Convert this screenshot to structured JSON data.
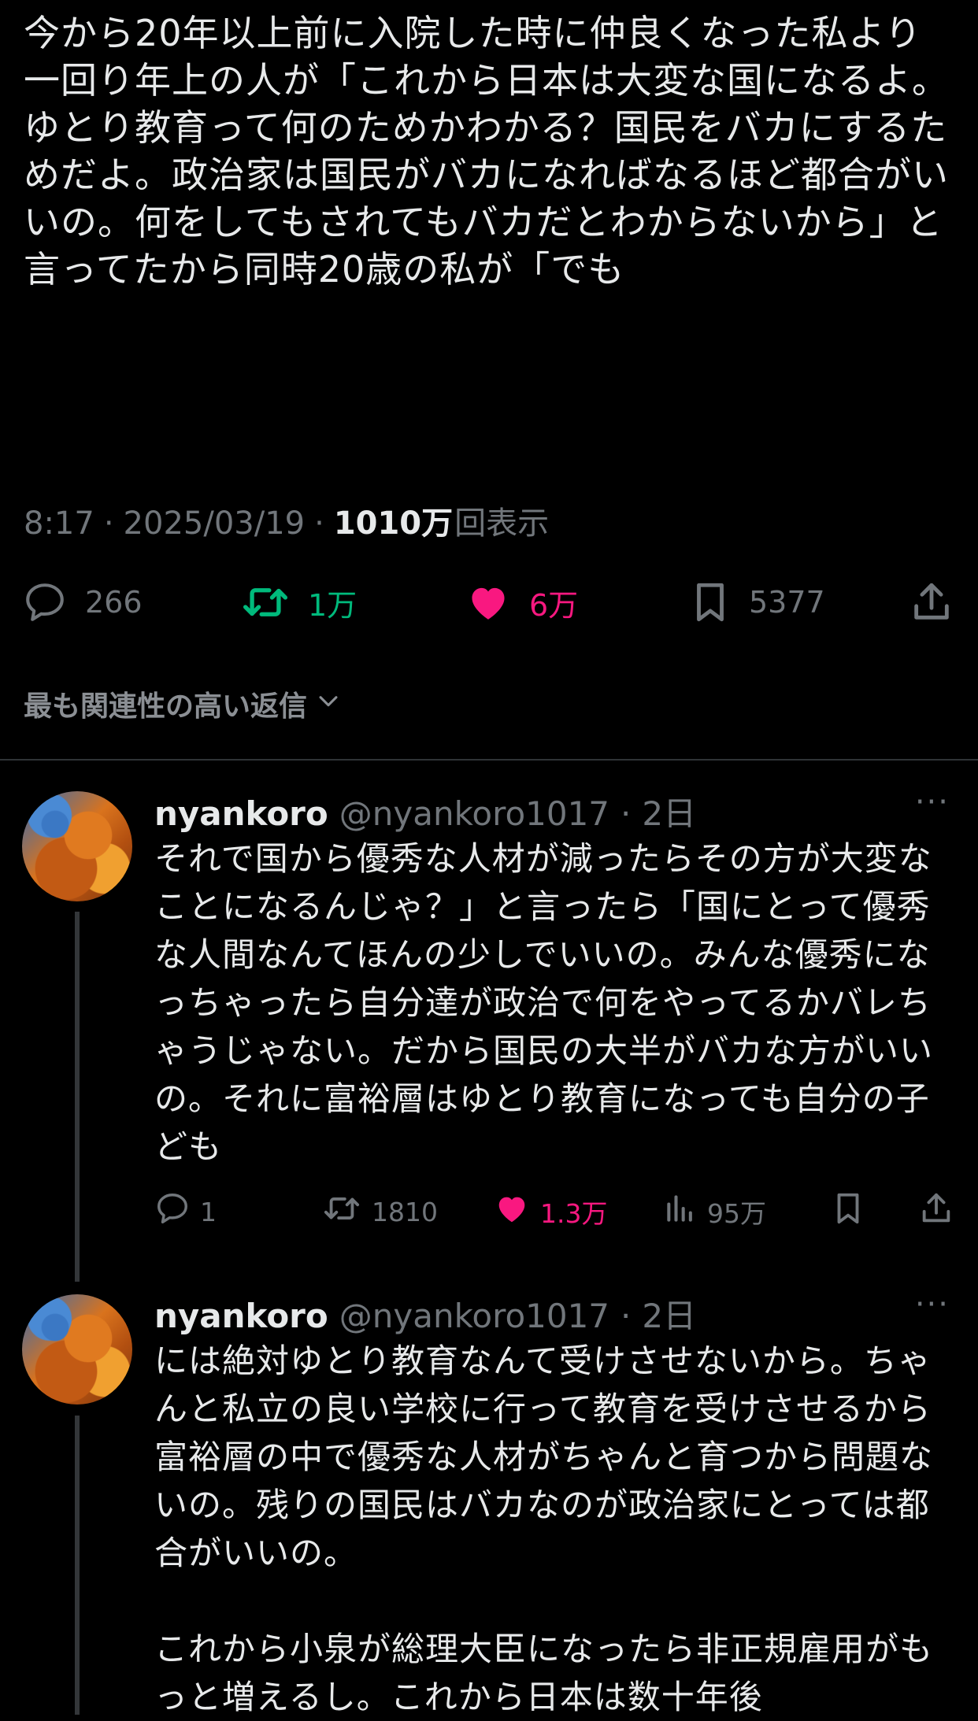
{
  "main_tweet": {
    "text": "今から20年以上前に入院した時に仲良くなった私より一回り年上の人が「これから日本は大変な国になるよ。ゆとり教育って何のためかわかる？国民をバカにするためだよ。政治家は国民がバカになればなるほど都合がいいの。何をしてもされてもバカだとわからないから」と言ってたから同時20歳の私が「でも",
    "time": "8:17",
    "date": "2025/03/19",
    "sep": "·",
    "views_count": "1010万",
    "views_label": "回表示",
    "replies": "266",
    "retweets": "1万",
    "likes": "6万",
    "bookmarks": "5377",
    "colors": {
      "retweet": "#00ba7c",
      "like": "#f91880"
    }
  },
  "relevance_label": "最も関連性の高い返信",
  "replies": [
    {
      "name": "nyankoro",
      "handle": "@nyankoro1017",
      "sep": "·",
      "time": "2日",
      "more": "···",
      "text": "それで国から優秀な人材が減ったらその方が大変なことになるんじゃ？」と言ったら「国にとって優秀な人間なんてほんの少しでいいの。みんな優秀になっちゃったら自分達が政治で何をやってるかバレちゃうじゃない。だから国民の大半がバカな方がいいの。それに富裕層はゆとり教育になっても自分の子ども",
      "replies": "1",
      "retweets": "1810",
      "likes": "1.3万",
      "views": "95万"
    },
    {
      "name": "nyankoro",
      "handle": "@nyankoro1017",
      "sep": "·",
      "time": "2日",
      "more": "···",
      "text": "には絶対ゆとり教育なんて受けさせないから。ちゃんと私立の良い学校に行って教育を受けさせるから富裕層の中で優秀な人材がちゃんと育つから問題ないの。残りの国民はバカなのが政治家にとっては都合がいいの。\n\nこれから小泉が総理大臣になったら非正規雇用がもっと増えるし。これから日本は数十年後"
    }
  ]
}
